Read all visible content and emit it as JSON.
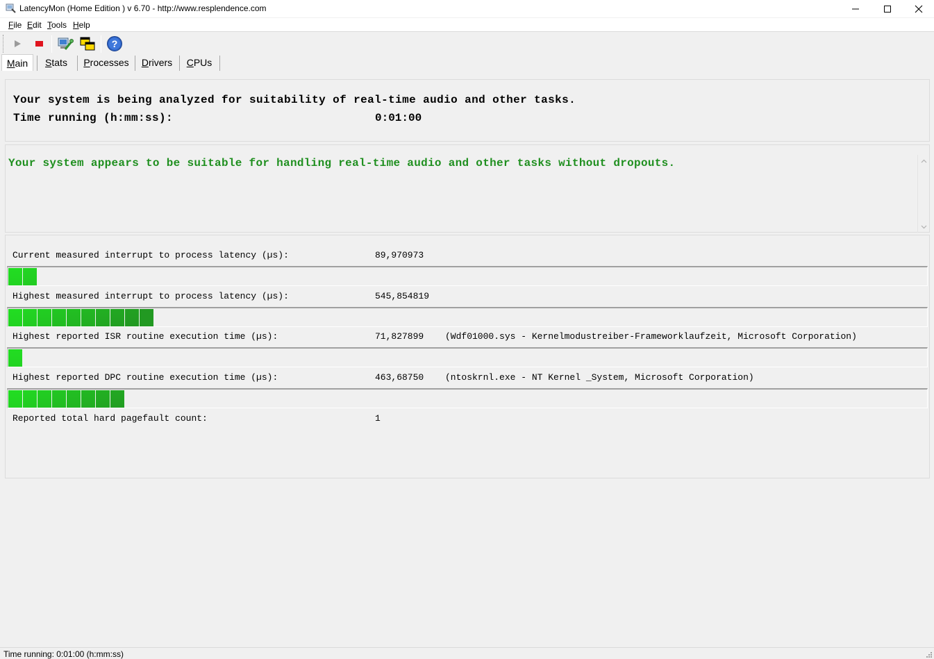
{
  "window": {
    "title": "LatencyMon  (Home Edition )  v 6.70 - http://www.resplendence.com",
    "minimize_icon": "minimize-icon",
    "maximize_icon": "maximize-icon",
    "close_icon": "close-icon"
  },
  "menu": {
    "items": [
      {
        "label": "File",
        "mnemonic": "F",
        "rest": "ile"
      },
      {
        "label": "Edit",
        "mnemonic": "E",
        "rest": "dit"
      },
      {
        "label": "Tools",
        "mnemonic": "T",
        "rest": "ools"
      },
      {
        "label": "Help",
        "mnemonic": "H",
        "rest": "elp"
      }
    ]
  },
  "toolbar": {
    "buttons": [
      {
        "name": "start-monitor",
        "icon": "play-icon",
        "enabled": false
      },
      {
        "name": "stop-monitor",
        "icon": "stop-icon",
        "enabled": true
      },
      {
        "name": "tools-submit",
        "icon": "wrench-computer-icon",
        "enabled": true
      },
      {
        "name": "windows-view",
        "icon": "windows-icon",
        "enabled": true
      },
      {
        "name": "help",
        "icon": "help-icon",
        "enabled": true
      }
    ]
  },
  "tabs": [
    {
      "label": "Main",
      "mnemonic": "M",
      "rest": "ain",
      "active": true
    },
    {
      "label": "Stats",
      "mnemonic": "S",
      "rest": "tats",
      "active": false
    },
    {
      "label": "Processes",
      "mnemonic": "P",
      "rest": "rocesses",
      "active": false
    },
    {
      "label": "Drivers",
      "mnemonic": "D",
      "rest": "rivers",
      "active": false
    },
    {
      "label": "CPUs",
      "mnemonic": "C",
      "rest": "PUs",
      "active": false
    }
  ],
  "analysis": {
    "line1": "Your system is being analyzed for suitability of real-time audio and other tasks.",
    "time_label": "Time running (h:mm:ss):",
    "time_value": "0:01:00"
  },
  "verdict": {
    "text": "Your system appears to be suitable for handling real-time audio and other tasks without dropouts.",
    "color": "#1f8f1f"
  },
  "metrics": [
    {
      "label": "Current measured interrupt to process latency (µs):",
      "value": "89,970973",
      "detail": "",
      "meter_segments": 2
    },
    {
      "label": "Highest measured interrupt to process latency (µs):",
      "value": "545,854819",
      "detail": "",
      "meter_segments": 10
    },
    {
      "label": "Highest reported ISR routine execution time (µs):",
      "value": "71,827899",
      "detail": "(Wdf01000.sys - Kernelmodustreiber-Frameworklaufzeit, Microsoft Corporation)",
      "meter_segments": 1
    },
    {
      "label": "Highest reported DPC routine execution time (µs):",
      "value": "463,68750",
      "detail": "(ntoskrnl.exe - NT Kernel _System, Microsoft Corporation)",
      "meter_segments": 8
    },
    {
      "label": "Reported total hard pagefault count:",
      "value": "1",
      "detail": ""
    }
  ],
  "status_bar": {
    "text": "Time running: 0:01:00  (h:mm:ss)"
  },
  "colors": {
    "meter_light": "#22dd22",
    "meter_dark": "#229922",
    "verdict_green": "#1f8f1f"
  }
}
